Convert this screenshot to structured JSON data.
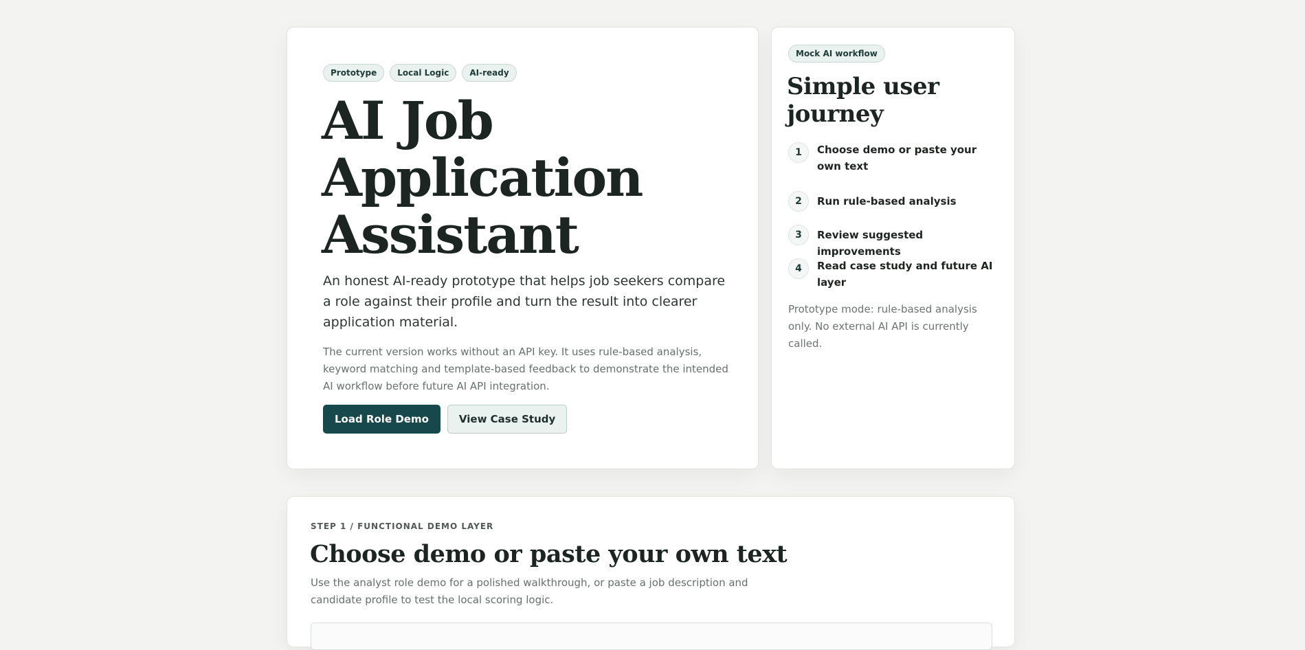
{
  "hero": {
    "tags": [
      "Prototype",
      "Local Logic",
      "AI-ready"
    ],
    "title_line1": "AI Job",
    "title_line2": "Application",
    "title_line3": "Assistant",
    "lead": "An honest AI-ready prototype that helps job seekers compare a role against their profile and turn the result into clearer application material.",
    "body": "The current version works without an API key. It uses rule-based analysis, keyword matching and template-based feedback to demonstrate the intended AI workflow before future AI API integration.",
    "primary_button": "Load Role Demo",
    "secondary_button": "View Case Study"
  },
  "journey": {
    "badge": "Mock AI workflow",
    "title": "Simple user journey",
    "steps": [
      {
        "num": "1",
        "label": "Choose demo or paste your own text"
      },
      {
        "num": "2",
        "label": "Run rule-based analysis"
      },
      {
        "num": "3",
        "label": "Review suggested improvements"
      },
      {
        "num": "4",
        "label": "Read case study and future AI layer"
      }
    ],
    "note": "Prototype mode: rule-based analysis only. No external AI API is currently called."
  },
  "demo": {
    "eyebrow": "STEP 1 / FUNCTIONAL DEMO LAYER",
    "title": "Choose demo or paste your own text",
    "description": "Use the analyst role demo for a polished walkthrough, or paste a job description and candidate profile to test the local scoring logic."
  },
  "colors": {
    "background": "#f3f3f1",
    "primary": "#17484b",
    "tag_background": "#eaf2f0",
    "text": "#1c2522",
    "muted": "#66706c"
  }
}
